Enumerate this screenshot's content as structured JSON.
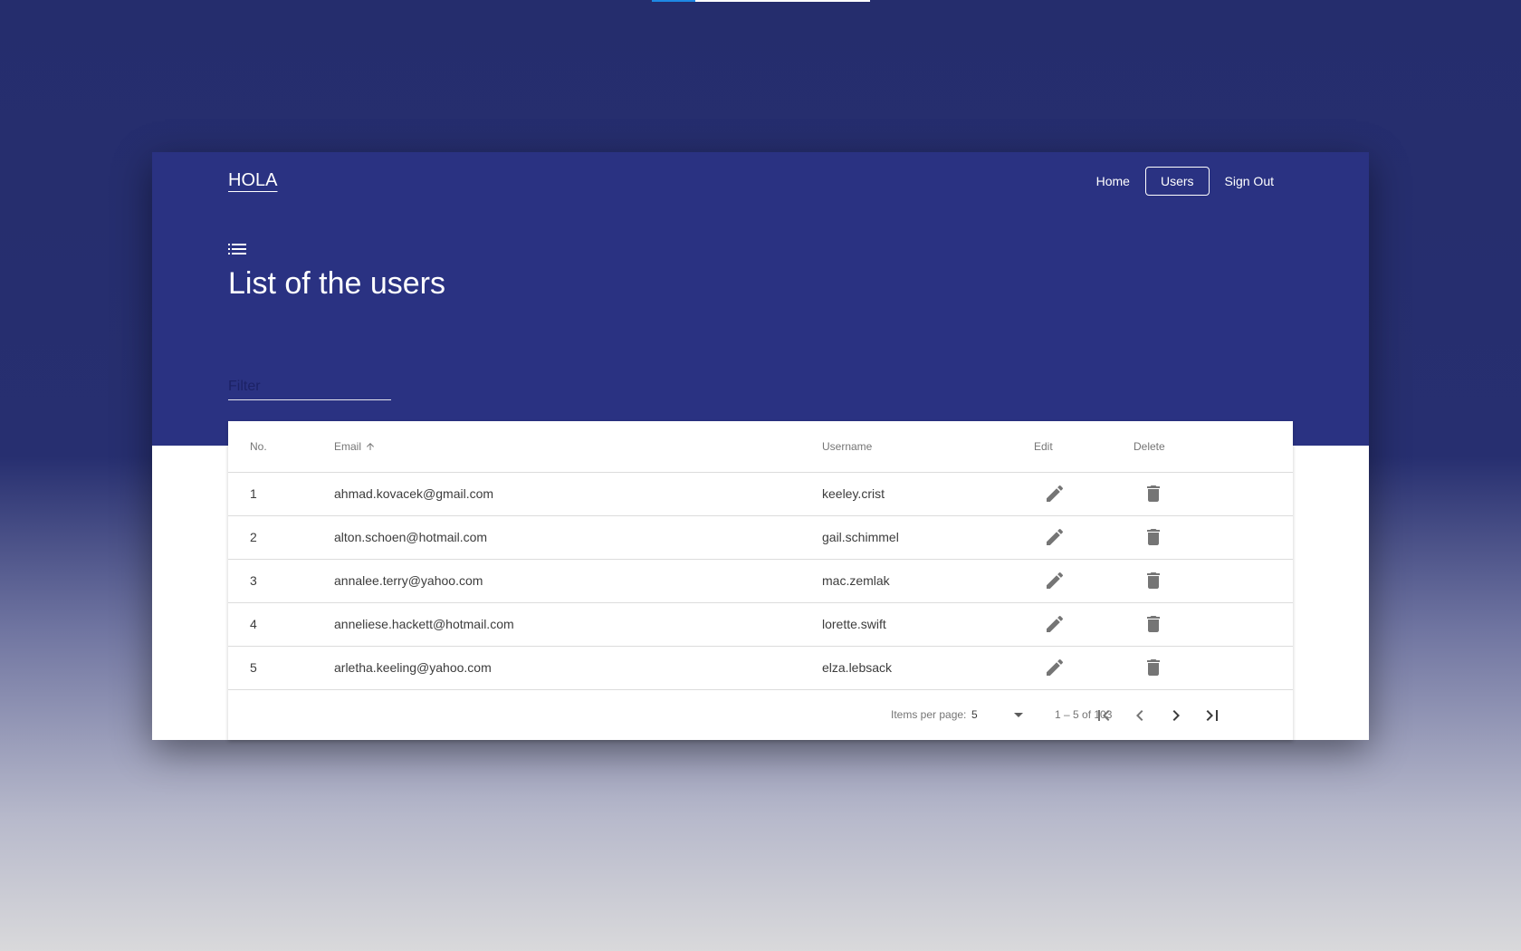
{
  "load_progress": 0.2,
  "colors": {
    "header_bg": "#2a3282",
    "accent": "#1e88e5",
    "icon": "#757575"
  },
  "brand": "HOLA",
  "nav": {
    "home": "Home",
    "users": "Users",
    "signout": "Sign Out"
  },
  "header_icon": "list-icon",
  "page_title": "List of the users",
  "filter": {
    "placeholder": "Filter",
    "value": ""
  },
  "table": {
    "columns": {
      "no": "No.",
      "email": "Email",
      "username": "Username",
      "edit": "Edit",
      "delete": "Delete"
    },
    "sort": {
      "column": "Email",
      "direction": "ascending",
      "icon": "arrow-up-icon"
    },
    "rows": [
      {
        "no": "1",
        "email": "ahmad.kovacek@gmail.com",
        "username": "keeley.crist"
      },
      {
        "no": "2",
        "email": "alton.schoen@hotmail.com",
        "username": "gail.schimmel"
      },
      {
        "no": "3",
        "email": "annalee.terry@yahoo.com",
        "username": "mac.zemlak"
      },
      {
        "no": "4",
        "email": "anneliese.hackett@hotmail.com",
        "username": "lorette.swift"
      },
      {
        "no": "5",
        "email": "arletha.keeling@yahoo.com",
        "username": "elza.lebsack"
      }
    ],
    "row_icons": {
      "edit": "pencil-icon",
      "delete": "trash-icon"
    }
  },
  "paginator": {
    "items_per_page_label": "Items per page:",
    "items_per_page": "5",
    "range": "1 – 5 of 103",
    "buttons": [
      "first-page-icon",
      "previous-page-icon",
      "next-page-icon",
      "last-page-icon"
    ]
  }
}
